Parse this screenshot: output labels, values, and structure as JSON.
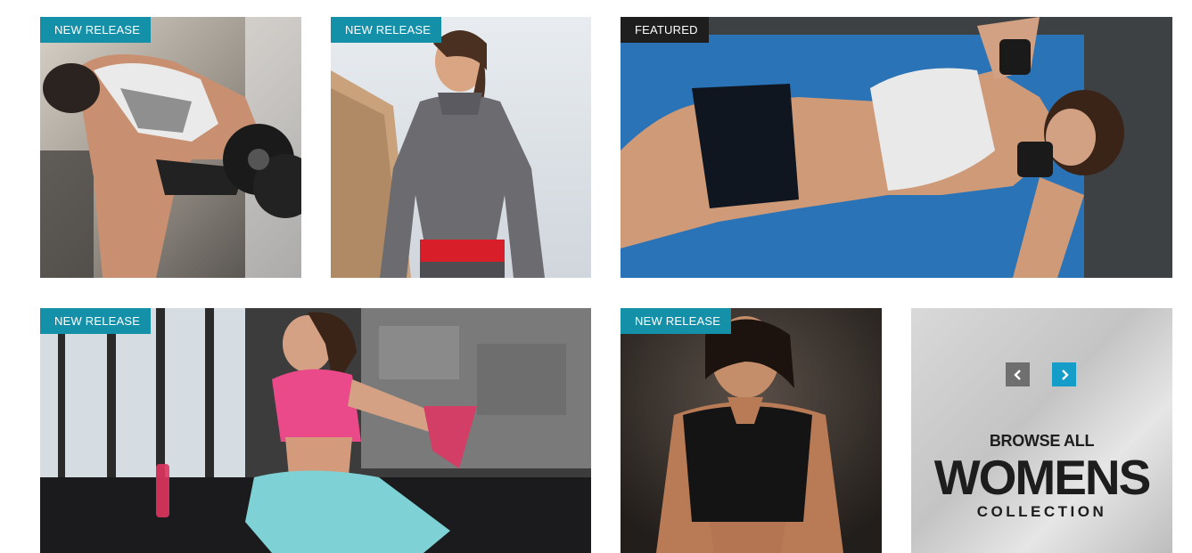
{
  "tiles": [
    {
      "badge": "NEW RELEASE",
      "subject": "woman-dumbbell-row"
    },
    {
      "badge": "NEW RELEASE",
      "subject": "woman-grey-hoodie-earphones"
    },
    {
      "badge": "FEATURED",
      "subject": "woman-situp-blue-mat"
    },
    {
      "badge": "NEW RELEASE",
      "subject": "woman-quad-stretch-gym"
    },
    {
      "badge": "NEW RELEASE",
      "subject": "woman-black-sports-bra"
    }
  ],
  "browse": {
    "line1": "BROWSE ALL",
    "line2": "WOMENS",
    "line3": "COLLECTION",
    "prev_icon": "chevron-left-icon",
    "next_icon": "chevron-right-icon"
  },
  "colors": {
    "badge_new": "#1590a9",
    "badge_featured": "#1e1e1e",
    "arrow_prev": "#6f6f6f",
    "arrow_next": "#139dc8"
  }
}
